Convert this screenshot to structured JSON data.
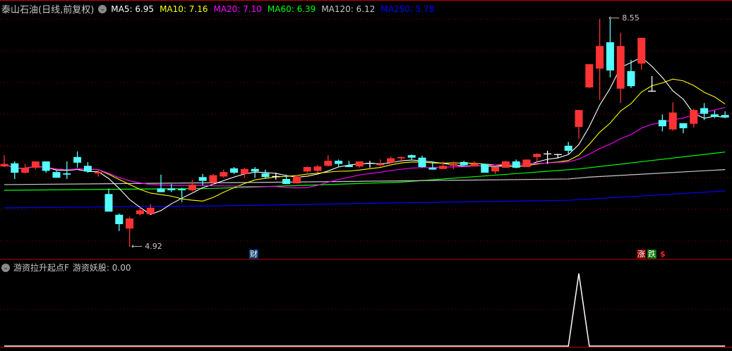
{
  "header": {
    "title": "泰山石油(日线,前复权)",
    "ma": [
      {
        "label": "MA5: 6.95",
        "color": "#ffffff"
      },
      {
        "label": "MA10: 7.16",
        "color": "#ffff00"
      },
      {
        "label": "MA20: 7.10",
        "color": "#ff00ff"
      },
      {
        "label": "MA60: 6.39",
        "color": "#00ff00"
      },
      {
        "label": "MA120: 6.12",
        "color": "#c8c8c8"
      },
      {
        "label": "MA250: 5.78",
        "color": "#0000ff"
      }
    ]
  },
  "price_labels": {
    "high": "8.55",
    "low": "4.92"
  },
  "markers": {
    "cai": "财",
    "zhang": "涨",
    "die": "跌",
    "dollar": "$"
  },
  "indicator": {
    "title": "游资拉升起点F",
    "value_label": "游资妖股: 0.00",
    "spike_index": 55
  },
  "colors": {
    "up": "#ff3333",
    "down": "#54ffff",
    "doji": "#ffffff",
    "grid": "#8b0000",
    "separator": "#c00000"
  },
  "candles": [
    [
      6.2,
      6.38,
      6.19,
      6.24
    ],
    [
      6.25,
      6.28,
      6.0,
      6.1
    ],
    [
      6.1,
      6.24,
      6.09,
      6.18
    ],
    [
      6.18,
      6.28,
      6.15,
      6.28
    ],
    [
      6.28,
      6.28,
      6.1,
      6.13
    ],
    [
      6.11,
      6.13,
      6.02,
      6.02
    ],
    [
      6.09,
      6.28,
      6.0,
      6.07
    ],
    [
      6.35,
      6.44,
      6.18,
      6.26
    ],
    [
      6.21,
      6.27,
      6.1,
      6.12
    ],
    [
      6.09,
      6.15,
      6.04,
      6.11
    ],
    [
      5.76,
      5.85,
      5.48,
      5.48
    ],
    [
      5.43,
      5.45,
      5.17,
      5.28
    ],
    [
      5.21,
      5.4,
      4.92,
      5.37
    ],
    [
      5.44,
      5.55,
      5.42,
      5.5
    ],
    [
      5.44,
      5.6,
      5.44,
      5.54
    ],
    [
      5.85,
      6.07,
      5.79,
      5.79
    ],
    [
      5.85,
      5.92,
      5.79,
      5.82
    ],
    [
      5.84,
      5.86,
      5.63,
      5.82
    ],
    [
      5.82,
      5.99,
      5.8,
      5.91
    ],
    [
      6.03,
      6.08,
      5.9,
      5.97
    ],
    [
      5.94,
      6.08,
      5.91,
      6.06
    ],
    [
      6.04,
      6.15,
      6.02,
      6.11
    ],
    [
      6.17,
      6.19,
      6.08,
      6.1
    ],
    [
      6.08,
      6.18,
      6.02,
      6.16
    ],
    [
      6.16,
      6.19,
      6.02,
      6.12
    ],
    [
      6.09,
      6.15,
      6.01,
      6.03
    ],
    [
      6.04,
      6.1,
      5.99,
      6.04
    ],
    [
      6.0,
      6.07,
      5.92,
      5.92
    ],
    [
      5.93,
      6.06,
      5.93,
      6.04
    ],
    [
      6.12,
      6.2,
      6.1,
      6.19
    ],
    [
      6.13,
      6.22,
      6.1,
      6.2
    ],
    [
      6.21,
      6.38,
      6.2,
      6.29
    ],
    [
      6.29,
      6.31,
      6.2,
      6.24
    ],
    [
      6.22,
      6.29,
      6.19,
      6.19
    ],
    [
      6.2,
      6.28,
      6.18,
      6.28
    ],
    [
      6.25,
      6.29,
      6.18,
      6.25
    ],
    [
      6.22,
      6.31,
      6.2,
      6.24
    ],
    [
      6.26,
      6.36,
      6.25,
      6.33
    ],
    [
      6.33,
      6.36,
      6.27,
      6.35
    ],
    [
      6.38,
      6.39,
      6.3,
      6.34
    ],
    [
      6.34,
      6.37,
      6.18,
      6.19
    ],
    [
      6.18,
      6.28,
      6.15,
      6.15
    ],
    [
      6.16,
      6.28,
      6.16,
      6.21
    ],
    [
      6.21,
      6.28,
      6.16,
      6.24
    ],
    [
      6.27,
      6.29,
      6.21,
      6.22
    ],
    [
      6.2,
      6.28,
      6.2,
      6.25
    ],
    [
      6.24,
      6.24,
      6.1,
      6.1
    ],
    [
      6.12,
      6.19,
      6.08,
      6.19
    ],
    [
      6.18,
      6.29,
      6.18,
      6.28
    ],
    [
      6.28,
      6.31,
      6.17,
      6.18
    ],
    [
      6.19,
      6.31,
      6.19,
      6.31
    ],
    [
      6.35,
      6.41,
      6.28,
      6.4
    ],
    [
      6.4,
      6.45,
      6.24,
      6.4
    ],
    [
      6.39,
      6.4,
      6.33,
      6.39
    ],
    [
      6.53,
      6.59,
      6.4,
      6.45
    ],
    [
      6.83,
      7.1,
      6.64,
      7.1
    ],
    [
      7.46,
      7.83,
      7.45,
      7.83
    ],
    [
      7.76,
      8.55,
      7.26,
      8.12
    ],
    [
      8.18,
      8.55,
      7.62,
      7.73
    ],
    [
      7.44,
      8.33,
      7.21,
      8.12
    ],
    [
      7.72,
      7.9,
      7.45,
      7.48
    ],
    [
      7.84,
      8.25,
      7.74,
      8.25
    ],
    [
      7.4,
      7.64,
      7.39,
      7.4
    ],
    [
      6.94,
      7.03,
      6.76,
      6.84
    ],
    [
      6.79,
      7.22,
      6.77,
      7.06
    ],
    [
      6.89,
      6.89,
      6.73,
      6.81
    ],
    [
      6.88,
      7.12,
      6.82,
      7.1
    ],
    [
      7.13,
      7.21,
      6.94,
      7.04
    ],
    [
      7.03,
      7.09,
      6.97,
      6.99
    ],
    [
      7.02,
      7.08,
      6.97,
      6.98
    ]
  ],
  "long_ma": {
    "ma60": {
      "idx": [
        0,
        20,
        38,
        55,
        69
      ],
      "val": [
        5.82,
        5.85,
        5.95,
        6.16,
        6.43
      ],
      "color": "#00ff00"
    },
    "ma120": {
      "idx": [
        0,
        27,
        54,
        56,
        69
      ],
      "val": [
        5.91,
        5.95,
        6.0,
        6.03,
        6.15
      ],
      "color": "#c8c8c8"
    },
    "ma250": {
      "idx": [
        0,
        20,
        38,
        54,
        69
      ],
      "val": [
        5.54,
        5.57,
        5.62,
        5.66,
        5.81
      ],
      "color": "#0000ff"
    }
  }
}
